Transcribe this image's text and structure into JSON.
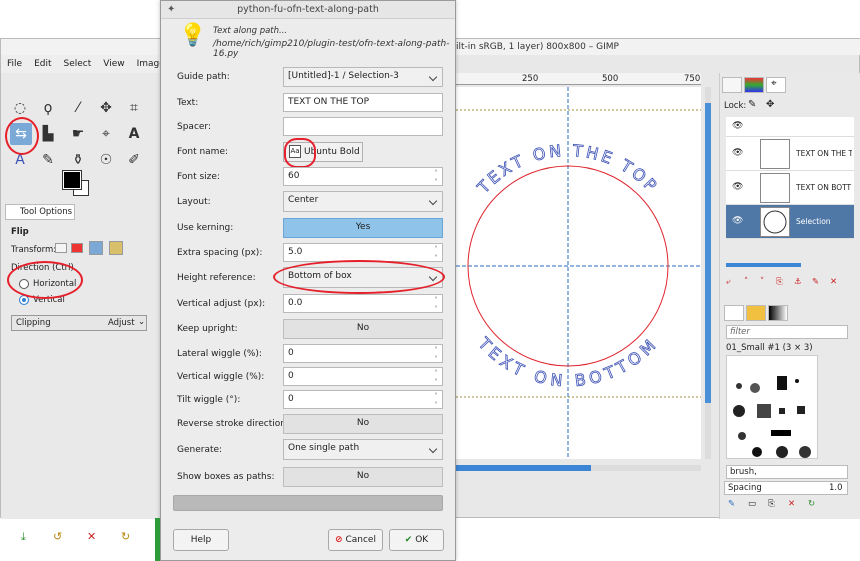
{
  "gimp": {
    "title": "ilt-in sRGB, 1 layer) 800x800 – GIMP",
    "menu": [
      "File",
      "Edit",
      "Select",
      "View",
      "Image"
    ],
    "tool_options_tab": "Tool Options",
    "tool_name": "Flip",
    "transform_label": "Transform:",
    "direction_label": "Direction  (Ctrl)",
    "horizontal_label": "Horizontal",
    "vertical_label": "Vertical",
    "clipping_label": "Clipping",
    "clipping_value": "Adjust",
    "ruler_labels": [
      "250",
      "500",
      "750"
    ],
    "canvas_text_top": "TEXT ON THE TOP",
    "canvas_text_bottom": "TEXT ON BOTTOM"
  },
  "dock": {
    "lock_label": "Lock:",
    "layers": [
      {
        "name": "TEXT ON THE T",
        "selected": false
      },
      {
        "name": "TEXT ON BOTT",
        "selected": false
      },
      {
        "name": "Selection",
        "selected": true
      }
    ],
    "filter_placeholder": "filter",
    "brush_set": "01_Small #1 (3 × 3)",
    "brush_tag": "brush,",
    "spacing_label": "Spacing",
    "spacing_value": "1.0"
  },
  "dialog": {
    "title": "python-fu-ofn-text-along-path",
    "desc_line1": "Text along path...",
    "desc_line2": "/home/rich/gimp210/plugin-test/ofn-text-along-path-16.py",
    "fields": {
      "guide_path": {
        "label": "Guide path:",
        "value": "[Untitled]-1 / Selection-3"
      },
      "text": {
        "label": "Text:",
        "value": "TEXT ON THE TOP"
      },
      "spacer": {
        "label": "Spacer:",
        "value": ""
      },
      "font_name": {
        "label": "Font name:",
        "value": "Ubuntu Bold"
      },
      "font_size": {
        "label": "Font size:",
        "value": "60"
      },
      "layout": {
        "label": "Layout:",
        "value": "Center"
      },
      "use_kerning": {
        "label": "Use kerning:",
        "value": "Yes"
      },
      "extra_spacing": {
        "label": "Extra spacing (px):",
        "value": "5.0"
      },
      "height_reference": {
        "label": "Height reference:",
        "value": "Bottom of box"
      },
      "vertical_adjust": {
        "label": "Vertical adjust (px):",
        "value": "0.0"
      },
      "keep_upright": {
        "label": "Keep upright:",
        "value": "No"
      },
      "lateral_wiggle": {
        "label": "Lateral wiggle (%):",
        "value": "0"
      },
      "vertical_wiggle": {
        "label": "Vertical wiggle (%):",
        "value": "0"
      },
      "tilt_wiggle": {
        "label": "Tilt wiggle (°):",
        "value": "0"
      },
      "reverse_stroke": {
        "label": "Reverse stroke direction:",
        "value": "No"
      },
      "generate": {
        "label": "Generate:",
        "value": "One single path"
      },
      "show_boxes": {
        "label": "Show boxes as paths:",
        "value": "No"
      }
    },
    "buttons": {
      "help": "Help",
      "cancel": "Cancel",
      "ok": "OK"
    }
  },
  "colors": {
    "accent": "#8fc3ea",
    "annotation": "#e5202a",
    "text_path": "#3a4fb4",
    "circle": "#e0262e"
  }
}
